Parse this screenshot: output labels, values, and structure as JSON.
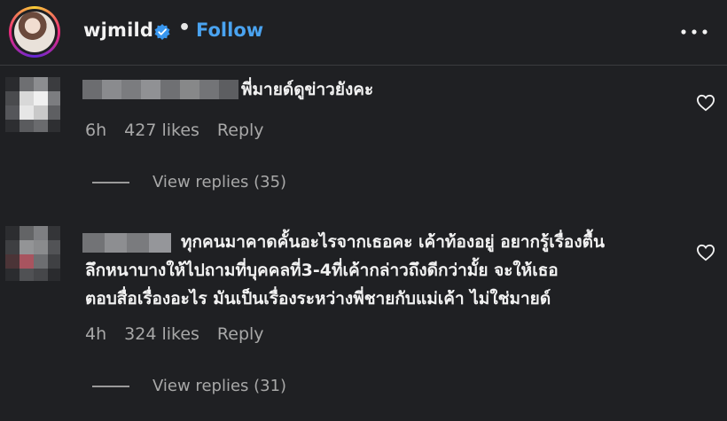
{
  "header": {
    "username": "wjmild",
    "separator": "•",
    "follow_label": "Follow",
    "more_icon": "more-horizontal-icon",
    "verified_icon": "verified-badge-icon"
  },
  "comments": [
    {
      "text": "พี่มายด์ดูข่าวยังคะ",
      "time": "6h",
      "likes": "427 likes",
      "reply_label": "Reply",
      "view_replies": "View replies (35)"
    },
    {
      "text_lines": [
        "ทุกคนมาคาดคั้นอะไรจากเธอคะ เค้าท้องอยู่ อยากรู้เรื่องตื้น",
        "ลึกหนาบางให้ไปถามที่บุคคลที่3-4ที่เค้ากล่าวถึงดีกว่ามั้ย จะให้เธอ",
        "ตอบสื่อเรื่องอะไร มันเป็นเรื่องระหว่างพี่ชายกับแม่เค้า ไม่ใช่มายด์"
      ],
      "time": "4h",
      "likes": "324 likes",
      "reply_label": "Reply",
      "view_replies": "View replies (31)"
    }
  ],
  "colors": {
    "background": "#1f2023",
    "follow": "#4aa3f0",
    "meta": "#a8a8a8",
    "text": "#f2f2f2"
  }
}
